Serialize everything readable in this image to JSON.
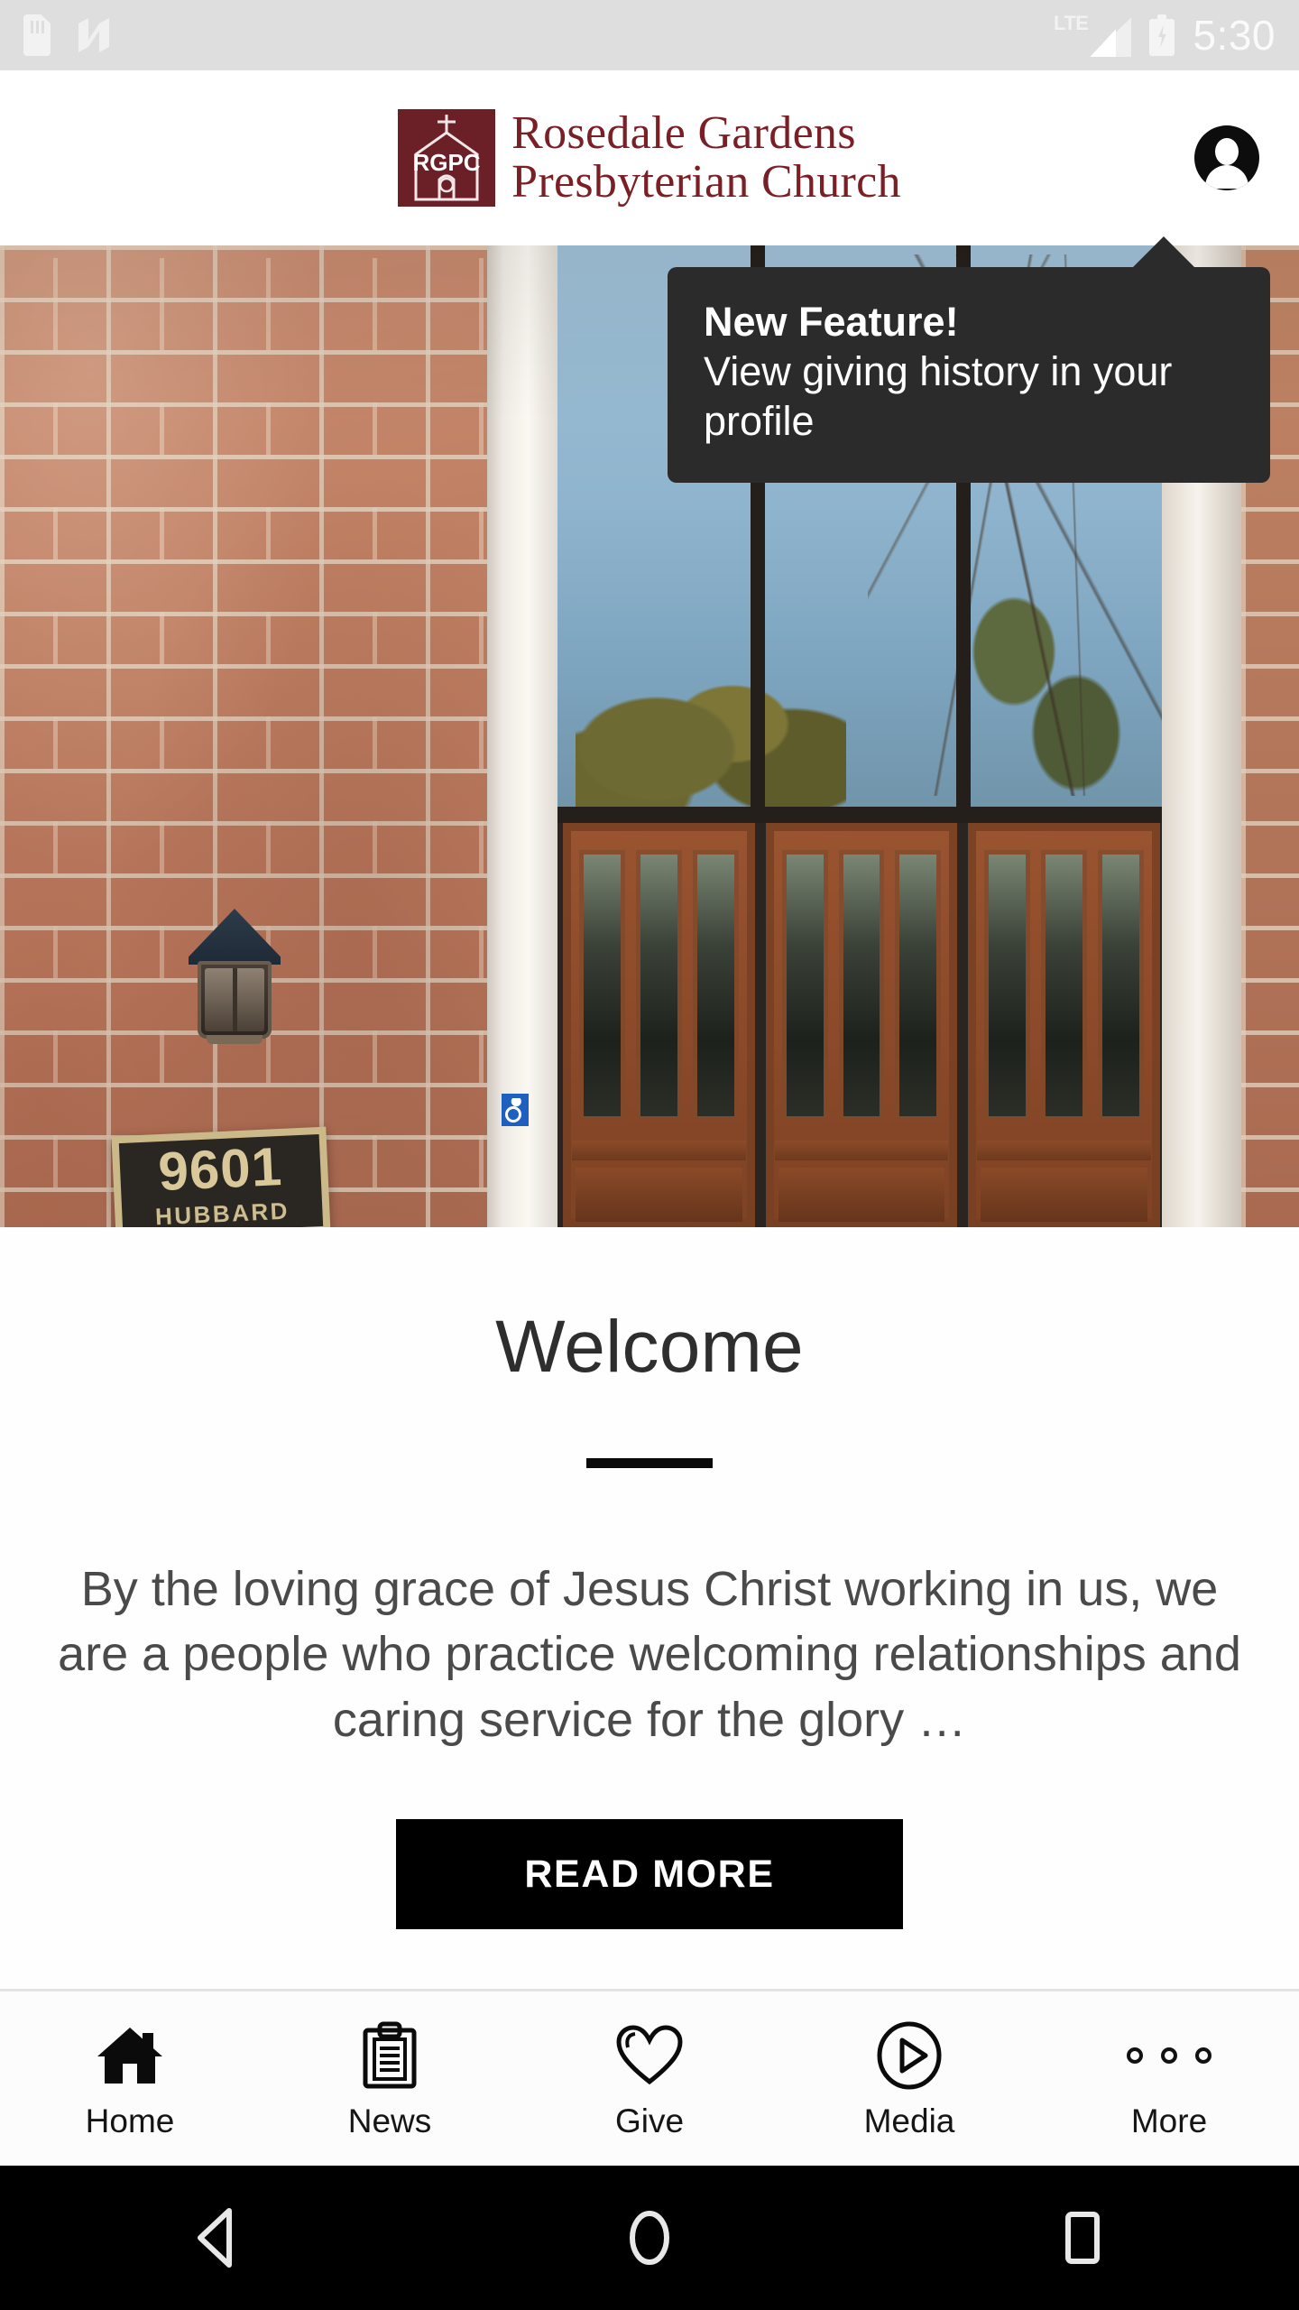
{
  "status_bar": {
    "time": "5:30",
    "network_label": "LTE",
    "icons": [
      "sd-card-icon",
      "android-n-icon",
      "lte-signal-icon",
      "battery-charging-icon"
    ]
  },
  "header": {
    "logo_mark_text": "RGPC",
    "brand_line1": "Rosedale Gardens",
    "brand_line2": "Presbyterian Church",
    "brand_color": "#7a1f25",
    "logo_bg_color": "#6b1f27",
    "avatar_label": "Profile"
  },
  "tooltip": {
    "title": "New Feature!",
    "body": "View giving history in your profile",
    "bg_color": "#2b2b2b",
    "text_color": "#ffffff"
  },
  "hero": {
    "alt": "Rosedale Gardens Presbyterian Church entrance",
    "address_number": "9601",
    "address_street": "HUBBARD"
  },
  "main": {
    "heading": "Welcome",
    "body": "By the loving grace of Jesus Christ working in us, we are a people who practice welcoming relationships and caring service for the glory …",
    "read_more_label": "READ MORE",
    "read_more_bg": "#000000"
  },
  "tabbar": {
    "items": [
      {
        "label": "Home",
        "icon": "home-icon",
        "active": true
      },
      {
        "label": "News",
        "icon": "clipboard-icon",
        "active": false
      },
      {
        "label": "Give",
        "icon": "heart-icon",
        "active": false
      },
      {
        "label": "Media",
        "icon": "play-circle-icon",
        "active": false
      },
      {
        "label": "More",
        "icon": "more-dots-icon",
        "active": false
      }
    ]
  },
  "system_nav": {
    "back": "Back",
    "home": "Home",
    "recents": "Recent apps"
  }
}
